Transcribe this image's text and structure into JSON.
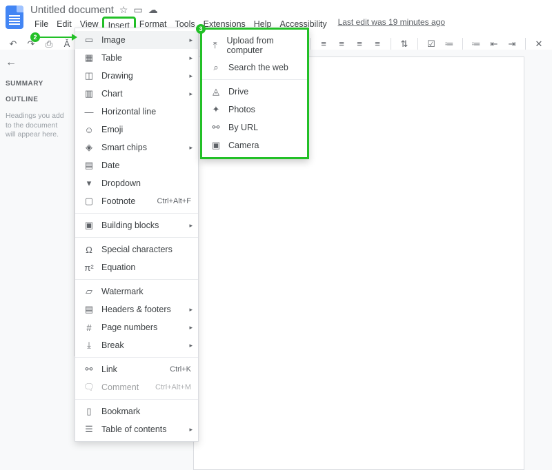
{
  "doc_title": "Untitled document",
  "menubar": [
    "File",
    "Edit",
    "View",
    "Insert",
    "Format",
    "Tools",
    "Extensions",
    "Help",
    "Accessibility"
  ],
  "active_menu_index": 3,
  "last_edit": "Last edit was 19 minutes ago",
  "sidebar": {
    "summary": "SUMMARY",
    "outline": "OUTLINE",
    "hint": "Headings you add to the document will appear here."
  },
  "insert_menu": [
    {
      "icon": "image-icon",
      "glyph": "▭",
      "label": "Image",
      "sub": true,
      "hl": true
    },
    {
      "icon": "table-icon",
      "glyph": "▦",
      "label": "Table",
      "sub": true
    },
    {
      "icon": "drawing-icon",
      "glyph": "◫",
      "label": "Drawing",
      "sub": true
    },
    {
      "icon": "chart-icon",
      "glyph": "▥",
      "label": "Chart",
      "sub": true
    },
    {
      "icon": "hr-icon",
      "glyph": "—",
      "label": "Horizontal line"
    },
    {
      "icon": "emoji-icon",
      "glyph": "☺",
      "label": "Emoji"
    },
    {
      "icon": "chips-icon",
      "glyph": "◈",
      "label": "Smart chips",
      "sub": true
    },
    {
      "icon": "date-icon",
      "glyph": "▤",
      "label": "Date"
    },
    {
      "icon": "dropdown-icon",
      "glyph": "▾",
      "label": "Dropdown"
    },
    {
      "icon": "footnote-icon",
      "glyph": "▢",
      "label": "Footnote",
      "shortcut": "Ctrl+Alt+F"
    },
    {
      "sep": true
    },
    {
      "icon": "blocks-icon",
      "glyph": "▣",
      "label": "Building blocks",
      "sub": true
    },
    {
      "sep": true
    },
    {
      "icon": "special-icon",
      "glyph": "Ω",
      "label": "Special characters"
    },
    {
      "icon": "equation-icon",
      "glyph": "π²",
      "label": "Equation"
    },
    {
      "sep": true
    },
    {
      "icon": "watermark-icon",
      "glyph": "▱",
      "label": "Watermark"
    },
    {
      "icon": "headers-icon",
      "glyph": "▤",
      "label": "Headers & footers",
      "sub": true
    },
    {
      "icon": "pagenum-icon",
      "glyph": "#",
      "label": "Page numbers",
      "sub": true
    },
    {
      "icon": "break-icon",
      "glyph": "⤓",
      "label": "Break",
      "sub": true
    },
    {
      "sep": true
    },
    {
      "icon": "link-icon",
      "glyph": "⚯",
      "label": "Link",
      "shortcut": "Ctrl+K"
    },
    {
      "icon": "comment-icon",
      "glyph": "🗨",
      "label": "Comment",
      "shortcut": "Ctrl+Alt+M",
      "disabled": true
    },
    {
      "sep": true
    },
    {
      "icon": "bookmark-icon",
      "glyph": "▯",
      "label": "Bookmark"
    },
    {
      "icon": "toc-icon",
      "glyph": "☰",
      "label": "Table of contents",
      "sub": true
    }
  ],
  "image_submenu": [
    {
      "icon": "upload-icon",
      "glyph": "⤒",
      "label": "Upload from computer"
    },
    {
      "icon": "search-icon",
      "glyph": "⌕",
      "label": "Search the web"
    },
    {
      "sep": true
    },
    {
      "icon": "drive-icon",
      "glyph": "◬",
      "label": "Drive"
    },
    {
      "icon": "photos-icon",
      "glyph": "✦",
      "label": "Photos"
    },
    {
      "icon": "url-icon",
      "glyph": "⚯",
      "label": "By URL"
    },
    {
      "icon": "camera-icon",
      "glyph": "▣",
      "label": "Camera"
    }
  ],
  "annotations": {
    "step2": "2",
    "step3": "3"
  }
}
